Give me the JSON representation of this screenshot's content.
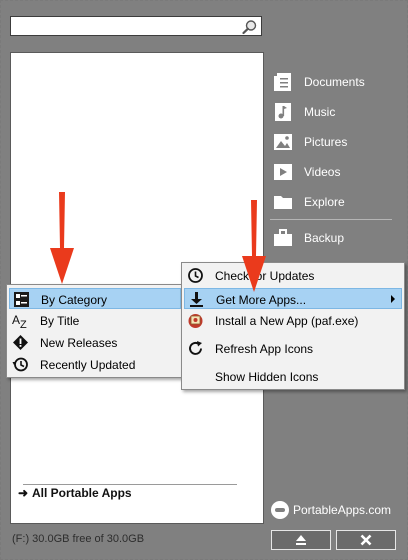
{
  "search": {
    "value": ""
  },
  "sidebar": {
    "items": [
      {
        "label": "Documents",
        "icon": "documents-icon"
      },
      {
        "label": "Music",
        "icon": "music-icon"
      },
      {
        "label": "Pictures",
        "icon": "pictures-icon"
      },
      {
        "label": "Videos",
        "icon": "videos-icon"
      },
      {
        "label": "Explore",
        "icon": "folder-icon"
      },
      {
        "label": "Backup",
        "icon": "backup-icon"
      }
    ]
  },
  "app_list": {
    "all_apps_label": "All Portable Apps"
  },
  "status_bar": {
    "drive_text": "(F:) 30.0GB free of 30.0GB"
  },
  "brand": {
    "logo_text": "PortableApps.com"
  },
  "buttons": {
    "eject_icon": "eject-icon",
    "close_icon": "close-icon"
  },
  "view_menu": {
    "items": [
      {
        "label": "By Category",
        "highlighted": true
      },
      {
        "label": "By Title"
      },
      {
        "label": "New Releases"
      },
      {
        "label": "Recently Updated"
      }
    ]
  },
  "apps_menu": {
    "items": [
      {
        "label": "Check for Updates"
      },
      {
        "label": "Get More Apps...",
        "highlighted": true,
        "has_submenu": true
      },
      {
        "label": "Install a New App (paf.exe)"
      },
      {
        "label": "Refresh App Icons"
      },
      {
        "label": "Show Hidden Icons"
      }
    ]
  },
  "colors": {
    "panel_gray": "#808080",
    "highlight": "#a7d2f3",
    "annotation_red": "#ea3a1c"
  }
}
